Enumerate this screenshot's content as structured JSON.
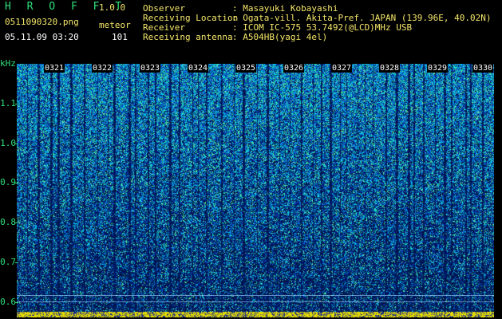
{
  "app": {
    "name": "H R O F F T",
    "version": "1.0.0"
  },
  "image": {
    "filename": "0511090320.png",
    "datetime": "05.11.09 03:20"
  },
  "detection": {
    "label": "meteor",
    "count": "101"
  },
  "station": [
    {
      "label": "Observer",
      "value": ": Masayuki Kobayashi"
    },
    {
      "label": "Receiving Location",
      "value": ": Ogata-vill. Akita-Pref. JAPAN (139.96E, 40.02N)"
    },
    {
      "label": "Receiver",
      "value": ": ICOM IC-575 53.7492(@LCD)MHz USB"
    },
    {
      "label": "Receiving antenna",
      "value": ": A504HB(yagi 4el)"
    }
  ],
  "axis": {
    "unit": "kHz",
    "y_ticks": [
      "1.1",
      "1.0",
      "0.9",
      "0.8",
      "0.7",
      "0.6"
    ],
    "time_marks": [
      "0321",
      "0322",
      "0323",
      "0324",
      "0325",
      "0326",
      "0327",
      "0328",
      "0329",
      "0330"
    ]
  },
  "colors": {
    "label_green": "#2fe07a",
    "label_yellow": "#f4e66a",
    "background": "#000000"
  }
}
